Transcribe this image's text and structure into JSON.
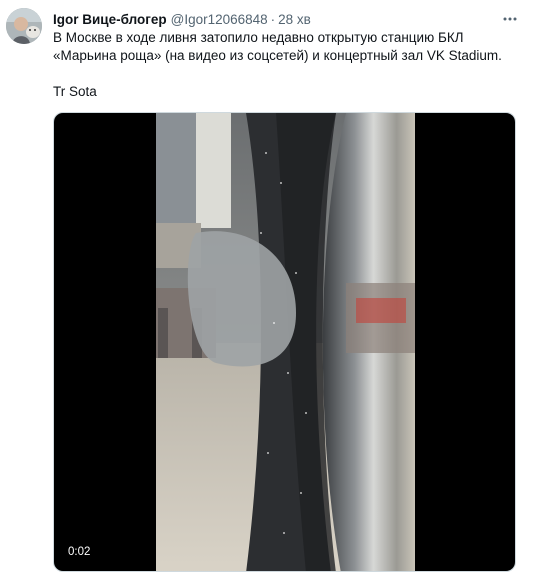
{
  "tweet": {
    "author_name": "Igor Вице-блогер",
    "author_handle": "@Igor12066848",
    "separator": "·",
    "timestamp": "28 хв",
    "text_lines": [
      "В Москве в ходе ливня затопило недавно открытую станцию БКЛ",
      "«Марьина роща» (на видео из соцсетей) и концертный зал VK Stadium."
    ],
    "signature": "Tr Sota",
    "more_icon": "more-options-icon",
    "video": {
      "duration": "0:02"
    }
  }
}
